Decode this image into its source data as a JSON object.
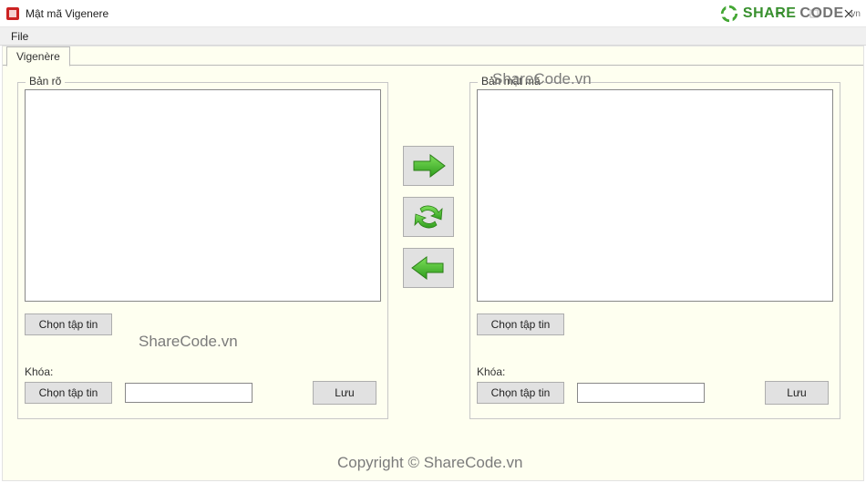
{
  "window": {
    "title": "Mật mã Vigenere"
  },
  "menu": {
    "file": "File"
  },
  "tab": {
    "label": "Vigenère"
  },
  "plaintext": {
    "legend": "Bản rõ",
    "value": "",
    "choose_file": "Chọn tập tin",
    "key_label": "Khóa:",
    "key_choose_file": "Chọn tập tin",
    "key_value": "",
    "save": "Lưu"
  },
  "ciphertext": {
    "legend": "Bản mật mã",
    "value": "",
    "choose_file": "Chọn tập tin",
    "key_label": "Khóa:",
    "key_choose_file": "Chọn tập tin",
    "key_value": "",
    "save": "Lưu"
  },
  "center": {
    "encrypt_icon": "arrow-right-icon",
    "swap_icon": "refresh-icon",
    "decrypt_icon": "arrow-left-icon"
  },
  "watermark": {
    "brand_share": "SHARE",
    "brand_code": "CODE",
    "brand_vn": ".vn",
    "text1": "ShareCode.vn",
    "text2": "ShareCode.vn",
    "copyright": "Copyright © ShareCode.vn"
  }
}
